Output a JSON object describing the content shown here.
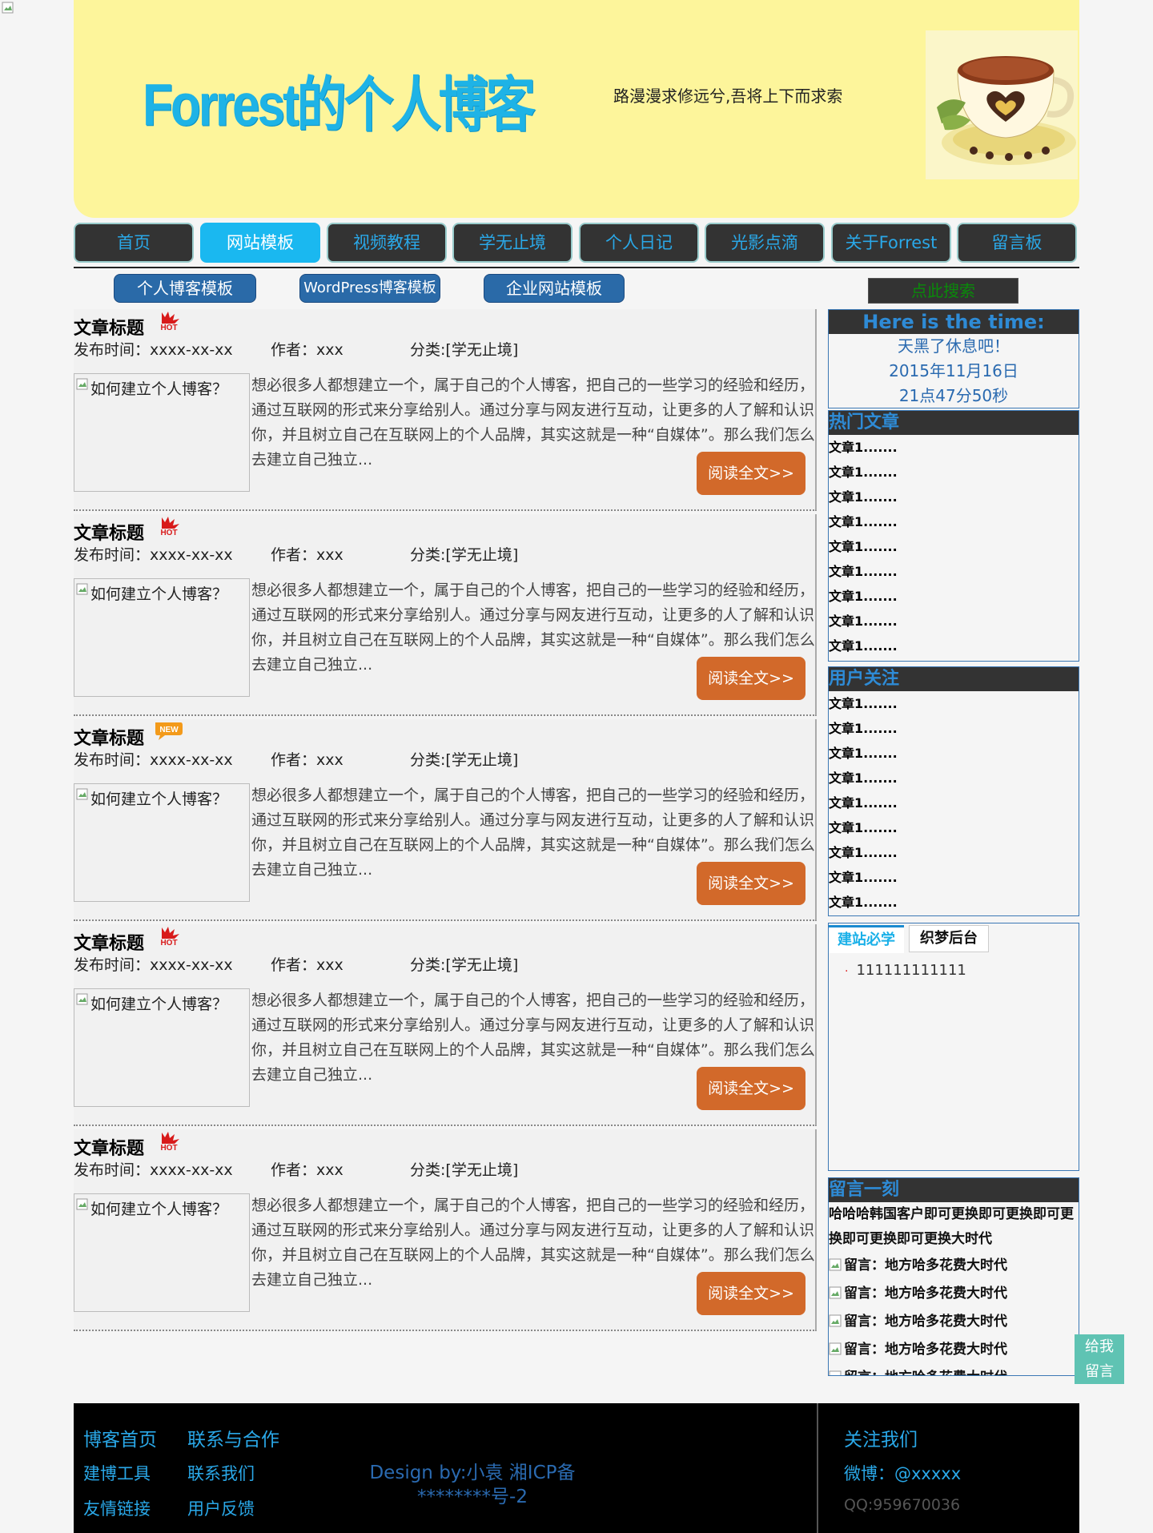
{
  "header": {
    "logo_text": "Forrest的个人博客",
    "motto": "路漫漫求修远兮,吾将上下而求索"
  },
  "nav": {
    "items": [
      "首页",
      "网站模板",
      "视频教程",
      "学无止境",
      "个人日记",
      "光影点滴",
      "关于Forrest",
      "留言板"
    ],
    "active_index": 1
  },
  "subnav": {
    "items": [
      "个人博客模板",
      "WordPress博客模板",
      "企业网站模板"
    ],
    "search_label": "点此搜索"
  },
  "articles": [
    {
      "title": "文章标题",
      "badge": "hot",
      "date": "发布时间：xxxx-xx-xx",
      "author": "作者：xxx",
      "category": "分类:[学无止境]",
      "thumb_alt": "如何建立个人博客？",
      "excerpt": "想必很多人都想建立一个，属于自己的个人博客，把自己的一些学习的经验和经历，通过互联网的形式来分享给别人。通过分享与网友进行互动，让更多的人了解和认识你，并且树立自己在互联网上的个人品牌，其实这就是一种“自媒体”。那么我们怎么去建立自己独立...",
      "read_more": "阅读全文>>"
    },
    {
      "title": "文章标题",
      "badge": "hot",
      "date": "发布时间：xxxx-xx-xx",
      "author": "作者：xxx",
      "category": "分类:[学无止境]",
      "thumb_alt": "如何建立个人博客？",
      "excerpt": "想必很多人都想建立一个，属于自己的个人博客，把自己的一些学习的经验和经历，通过互联网的形式来分享给别人。通过分享与网友进行互动，让更多的人了解和认识你，并且树立自己在互联网上的个人品牌，其实这就是一种“自媒体”。那么我们怎么去建立自己独立...",
      "read_more": "阅读全文>>"
    },
    {
      "title": "文章标题",
      "badge": "new",
      "date": "发布时间：xxxx-xx-xx",
      "author": "作者：xxx",
      "category": "分类:[学无止境]",
      "thumb_alt": "如何建立个人博客？",
      "excerpt": "想必很多人都想建立一个，属于自己的个人博客，把自己的一些学习的经验和经历，通过互联网的形式来分享给别人。通过分享与网友进行互动，让更多的人了解和认识你，并且树立自己在互联网上的个人品牌，其实这就是一种“自媒体”。那么我们怎么去建立自己独立...",
      "read_more": "阅读全文>>"
    },
    {
      "title": "文章标题",
      "badge": "hot",
      "date": "发布时间：xxxx-xx-xx",
      "author": "作者：xxx",
      "category": "分类:[学无止境]",
      "thumb_alt": "如何建立个人博客？",
      "excerpt": "想必很多人都想建立一个，属于自己的个人博客，把自己的一些学习的经验和经历，通过互联网的形式来分享给别人。通过分享与网友进行互动，让更多的人了解和认识你，并且树立自己在互联网上的个人品牌，其实这就是一种“自媒体”。那么我们怎么去建立自己独立...",
      "read_more": "阅读全文>>"
    },
    {
      "title": "文章标题",
      "badge": "hot",
      "date": "发布时间：xxxx-xx-xx",
      "author": "作者：xxx",
      "category": "分类:[学无止境]",
      "thumb_alt": "如何建立个人博客？",
      "excerpt": "想必很多人都想建立一个，属于自己的个人博客，把自己的一些学习的经验和经历，通过互联网的形式来分享给别人。通过分享与网友进行互动，让更多的人了解和认识你，并且树立自己在互联网上的个人品牌，其实这就是一种“自媒体”。那么我们怎么去建立自己独立...",
      "read_more": "阅读全文>>"
    }
  ],
  "sidebar": {
    "time": {
      "heading": "Here is the time:",
      "greeting": "天黑了休息吧！",
      "date": "2015年11月16日",
      "clock": "21点47分50秒"
    },
    "hot": {
      "heading": "热门文章",
      "items": [
        "文章1.......",
        "文章1.......",
        "文章1.......",
        "文章1.......",
        "文章1.......",
        "文章1.......",
        "文章1.......",
        "文章1.......",
        "文章1......."
      ]
    },
    "follow": {
      "heading": "用户关注",
      "items": [
        "文章1.......",
        "文章1.......",
        "文章1.......",
        "文章1.......",
        "文章1.......",
        "文章1.......",
        "文章1.......",
        "文章1.......",
        "文章1......."
      ]
    },
    "tabs": {
      "tab1": "建站必学",
      "tab2": "织梦后台",
      "item": "111111111111"
    },
    "messages": {
      "heading": "留言一刻",
      "intro": "哈哈哈韩国客户即可更换即可更换即可更换即可更换即可更换大时代",
      "items": [
        "留言：地方哈多花费大时代",
        "留言：地方哈多花费大时代",
        "留言：地方哈多花费大时代",
        "留言：地方哈多花费大时代",
        "留言：地方哈多花费大时代"
      ]
    },
    "float_btn": [
      "给我",
      "留言"
    ]
  },
  "footer": {
    "col1": [
      "博客首页",
      "建博工具",
      "友情链接"
    ],
    "col2": [
      "联系与合作",
      "联系我们",
      "用户反馈"
    ],
    "design": [
      "Design by:小袁 湘ICP备",
      "********号-2"
    ],
    "follow_heading": "关注我们",
    "weibo": "微博：@xxxxx",
    "qq": "QQ:959670036"
  },
  "colors": {
    "header_bg": "#fdf59b",
    "nav_active": "#1ab8f0",
    "read_more": "#d2692a",
    "link_blue": "#2aa8e8"
  }
}
